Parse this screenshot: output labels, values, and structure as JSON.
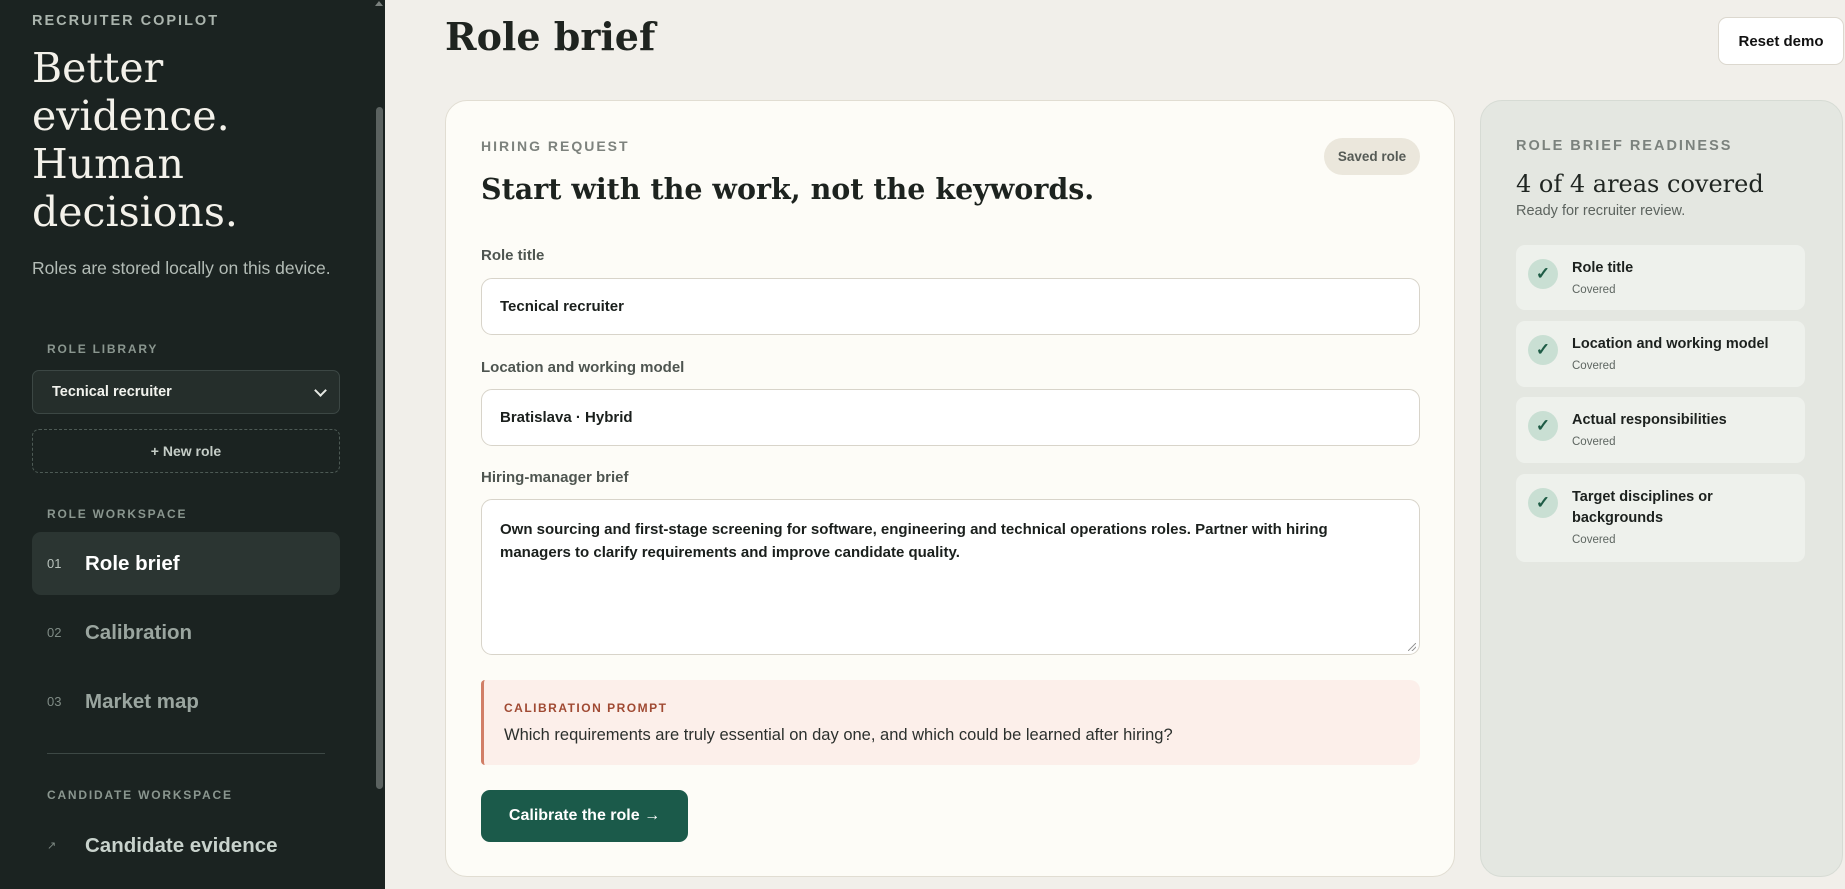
{
  "sidebar": {
    "brand_kicker": "RECRUITER COPILOT",
    "tagline": "Better evidence. Human decisions.",
    "store_note": "Roles are stored locally on this device.",
    "role_library_label": "ROLE LIBRARY",
    "selected_role": "Tecnical recruiter",
    "new_role_label": "+ New role",
    "role_workspace_label": "ROLE WORKSPACE",
    "nav": [
      {
        "num": "01",
        "label": "Role brief",
        "active": true
      },
      {
        "num": "02",
        "label": "Calibration",
        "active": false
      },
      {
        "num": "03",
        "label": "Market map",
        "active": false
      }
    ],
    "candidate_workspace_label": "CANDIDATE WORKSPACE",
    "candidate_nav": {
      "icon": "arrow-up-right-icon",
      "num": "↗",
      "label": "Candidate evidence"
    }
  },
  "header": {
    "title": "Role brief",
    "reset_label": "Reset demo"
  },
  "form": {
    "kicker": "HIRING REQUEST",
    "saved_pill": "Saved role",
    "heading": "Start with the work, not the keywords.",
    "role_title_label": "Role title",
    "role_title_value": "Tecnical recruiter",
    "location_label": "Location and working model",
    "location_value": "Bratislava · Hybrid",
    "brief_label": "Hiring-manager brief",
    "brief_value": "Own sourcing and first-stage screening for software, engineering and technical operations roles. Partner with hiring managers to clarify requirements and improve candidate quality.",
    "prompt_kicker": "CALIBRATION PROMPT",
    "prompt_text": "Which requirements are truly essential on day one, and which could be learned after hiring?",
    "primary_button": "Calibrate the role →"
  },
  "readiness": {
    "kicker": "ROLE BRIEF READINESS",
    "count": "4 of 4 areas covered",
    "sub": "Ready for recruiter review.",
    "items": [
      {
        "check": "✓",
        "title": "Role title",
        "status": "Covered"
      },
      {
        "check": "✓",
        "title": "Location and working model",
        "status": "Covered"
      },
      {
        "check": "✓",
        "title": "Actual responsibilities",
        "status": "Covered"
      },
      {
        "check": "✓",
        "title": "Target disciplines or backgrounds",
        "status": "Covered"
      }
    ]
  },
  "colors": {
    "sidebar_bg": "#1b2321",
    "accent": "#1b5a4a",
    "page_bg": "#f1efea",
    "prompt_accent": "#d17e66"
  }
}
